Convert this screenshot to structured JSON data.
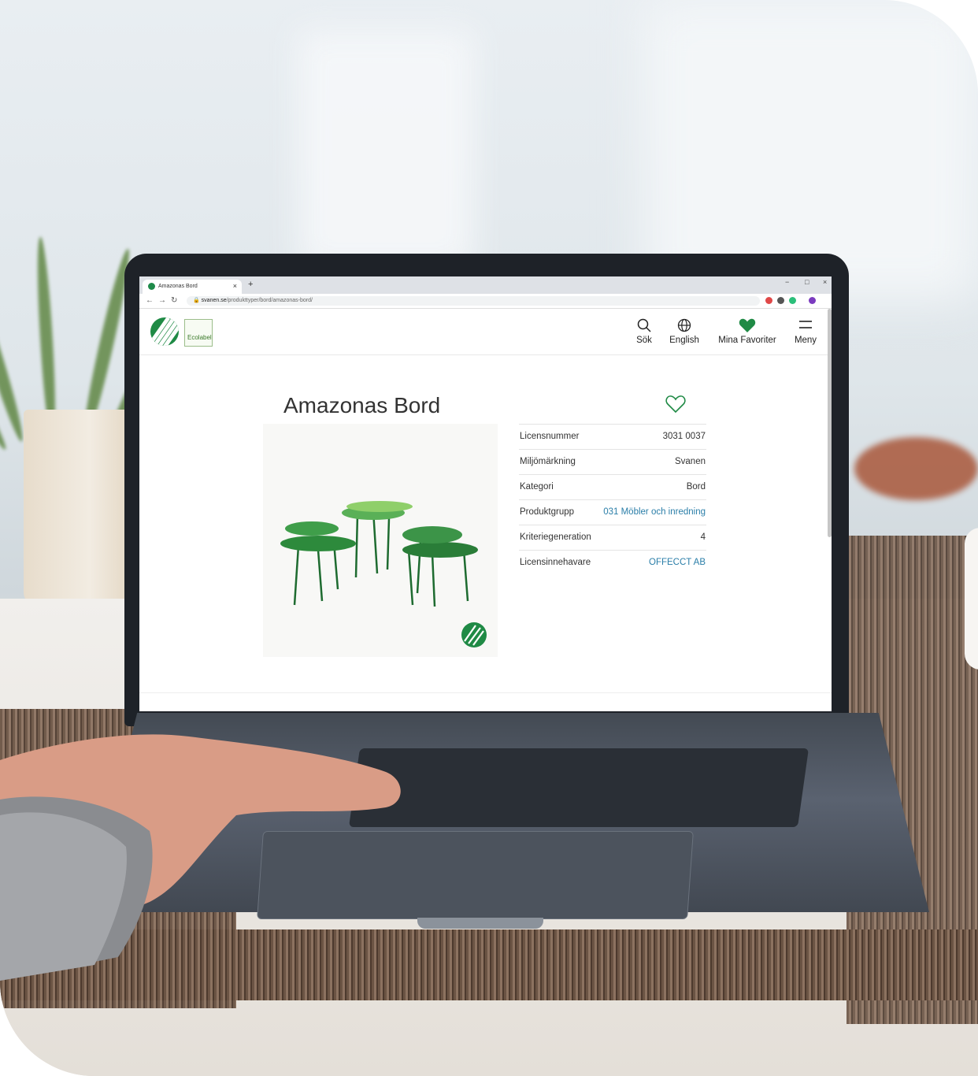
{
  "browser": {
    "tab_title": "Amazonas Bord",
    "tab_close": "×",
    "new_tab": "+",
    "url_host": "svanen.se",
    "url_path": "/produkttyper/bord/amazonas-bord/",
    "window_controls": [
      "−",
      "□",
      "×"
    ]
  },
  "header": {
    "nav": [
      {
        "label": "Sök",
        "icon": "search-icon"
      },
      {
        "label": "English",
        "icon": "globe-icon"
      },
      {
        "label": "Mina Favoriter",
        "icon": "heart-icon"
      },
      {
        "label": "Meny",
        "icon": "menu-icon"
      }
    ],
    "ecolabel_text": "Ecolabel"
  },
  "product": {
    "title": "Amazonas Bord",
    "details": [
      {
        "key": "Licensnummer",
        "value": "3031 0037",
        "link": false
      },
      {
        "key": "Miljömärkning",
        "value": "Svanen",
        "link": false
      },
      {
        "key": "Kategori",
        "value": "Bord",
        "link": false
      },
      {
        "key": "Produktgrupp",
        "value": "031 Möbler och inredning",
        "link": true
      },
      {
        "key": "Kriteriegeneration",
        "value": "4",
        "link": false
      },
      {
        "key": "Licensinnehavare",
        "value": "OFFECCT AB",
        "link": true
      }
    ]
  },
  "colors": {
    "brand_green": "#1f8a45",
    "link_blue": "#2a7ea8",
    "text": "#333333"
  }
}
